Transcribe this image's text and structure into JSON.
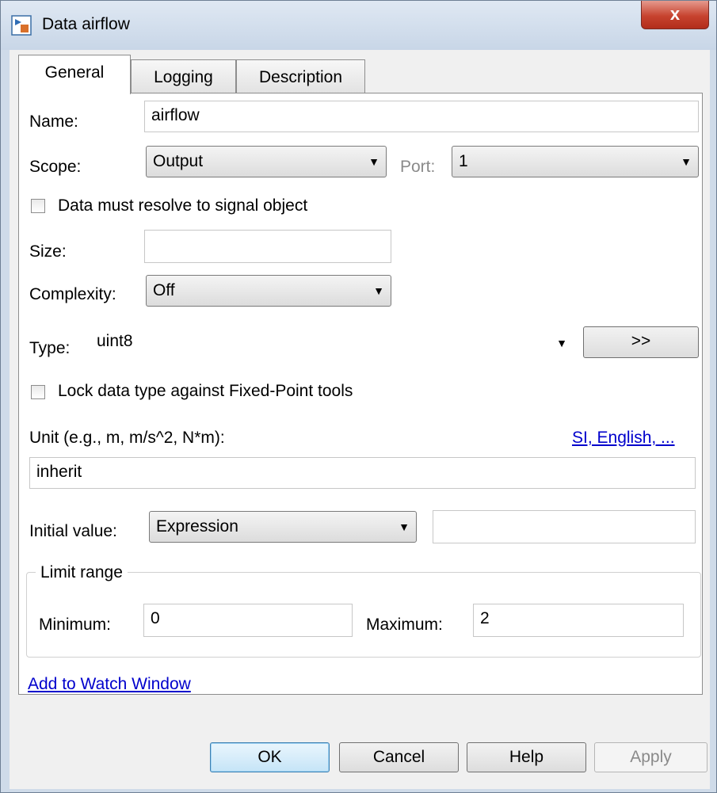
{
  "window": {
    "title": "Data airflow",
    "close_glyph": "x"
  },
  "tabs": [
    {
      "label": "General",
      "active": true
    },
    {
      "label": "Logging",
      "active": false
    },
    {
      "label": "Description",
      "active": false
    }
  ],
  "general": {
    "name_label": "Name:",
    "name_value": "airflow",
    "scope_label": "Scope:",
    "scope_value": "Output",
    "port_label": "Port:",
    "port_value": "1",
    "resolve_label": "Data must resolve to signal object",
    "resolve_checked": false,
    "size_label": "Size:",
    "size_value": "",
    "complexity_label": "Complexity:",
    "complexity_value": "Off",
    "type_label": "Type:",
    "type_value": "uint8",
    "type_button": ">>",
    "lock_label": "Lock data type against Fixed-Point tools",
    "lock_checked": false,
    "unit_label": "Unit (e.g., m, m/s^2, N*m):",
    "unit_link": "SI, English, ...",
    "unit_value": "inherit",
    "initial_label": "Initial value:",
    "initial_mode": "Expression",
    "initial_value": "",
    "limit_group": "Limit range",
    "minimum_label": "Minimum:",
    "minimum_value": "0",
    "maximum_label": "Maximum:",
    "maximum_value": "2",
    "watch_link": "Add to Watch Window"
  },
  "buttons": {
    "ok": "OK",
    "cancel": "Cancel",
    "help": "Help",
    "apply": "Apply"
  },
  "icons": {
    "app": "stateflow-data-icon",
    "dropdown": "chevron-down-icon",
    "close": "close-icon"
  },
  "colors": {
    "link": "#0000cc",
    "close_button": "#c7432f",
    "disabled_text": "#8a8a8a"
  }
}
